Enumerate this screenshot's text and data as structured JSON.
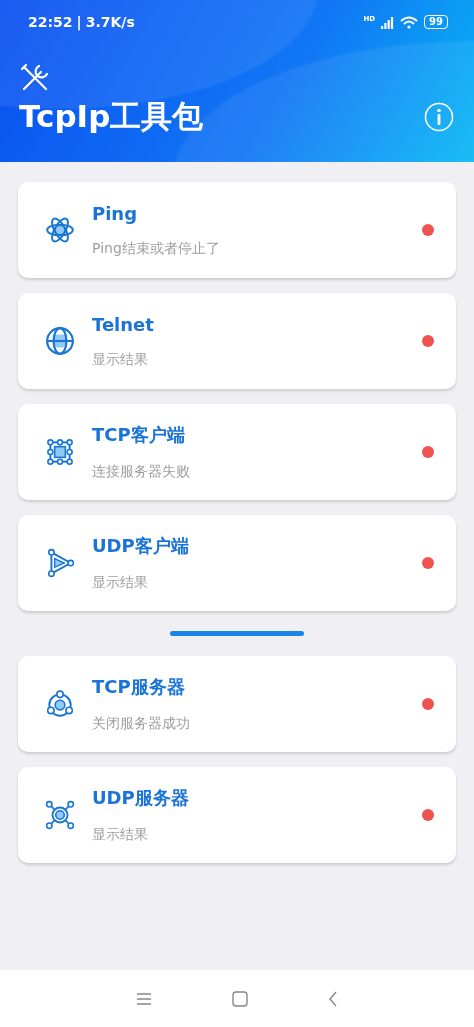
{
  "status_bar": {
    "time": "22:52",
    "separator": "|",
    "speed": "3.7K/s",
    "network": "HD",
    "battery": "99"
  },
  "app_bar": {
    "title": "TcpIp工具包"
  },
  "groups": [
    {
      "items": [
        {
          "title": "Ping",
          "subtitle": "Ping结束或者停止了",
          "color": "#ef5350"
        },
        {
          "title": "Telnet",
          "subtitle": "显示结果",
          "color": "#ef5350"
        },
        {
          "title": "TCP客户端",
          "subtitle": "连接服务器失败",
          "color": "#ef5350"
        },
        {
          "title": "UDP客户端",
          "subtitle": "显示结果",
          "color": "#ef5350"
        }
      ]
    },
    {
      "items": [
        {
          "title": "TCP服务器",
          "subtitle": "关闭服务器成功",
          "color": "#ef5350"
        },
        {
          "title": "UDP服务器",
          "subtitle": "显示结果",
          "color": "#ef5350"
        }
      ]
    }
  ]
}
